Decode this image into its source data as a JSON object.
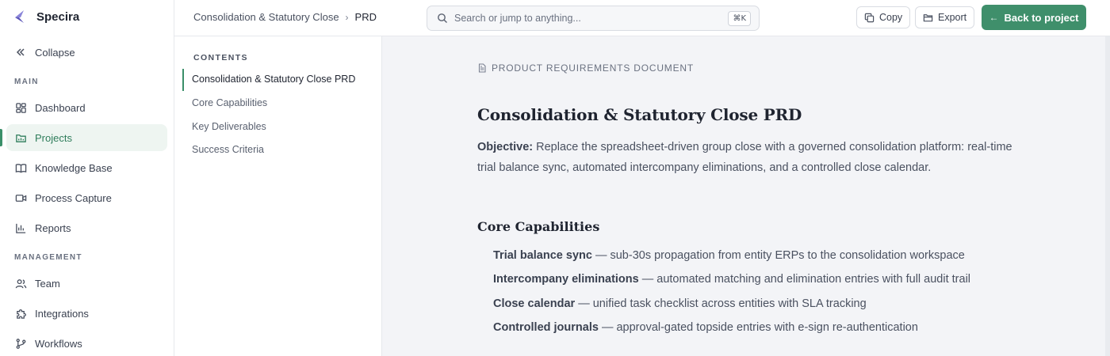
{
  "brand": {
    "name": "Specira",
    "accent": "#3f8f6b"
  },
  "sidebar": {
    "collapse_label": "Collapse",
    "sections": {
      "main": "MAIN",
      "management": "MANAGEMENT"
    },
    "items": [
      {
        "label": "Dashboard",
        "icon": "dashboard-icon"
      },
      {
        "label": "Projects",
        "icon": "folder-icon",
        "active": true
      },
      {
        "label": "Knowledge Base",
        "icon": "book-icon"
      },
      {
        "label": "Process Capture",
        "icon": "video-icon"
      },
      {
        "label": "Reports",
        "icon": "bar-chart-icon"
      },
      {
        "label": "Team",
        "icon": "users-icon"
      },
      {
        "label": "Integrations",
        "icon": "puzzle-icon"
      },
      {
        "label": "Workflows",
        "icon": "git-branch-icon"
      }
    ]
  },
  "header": {
    "breadcrumb": [
      "Consolidation & Statutory Close",
      "PRD"
    ],
    "breadcrumb_sep": "›",
    "search_placeholder": "Search or jump to anything...",
    "search_shortcut": "⌘K",
    "copy_label": "Copy",
    "export_label": "Export",
    "back_label": "Back to project"
  },
  "toc": {
    "title": "CONTENTS",
    "items": [
      "Consolidation & Statutory Close PRD",
      "Core Capabilities",
      "Key Deliverables",
      "Success Criteria"
    ]
  },
  "doc": {
    "kicker": "PRODUCT REQUIREMENTS DOCUMENT",
    "title": "Consolidation & Statutory Close PRD",
    "objective_label": "Objective:",
    "objective_text": " Replace the spreadsheet-driven group close with a governed consolidation platform: real-time trial balance sync, automated intercompany eliminations, and a controlled close calendar.",
    "section_title": "Core Capabilities",
    "capabilities": [
      {
        "name": "Trial balance sync",
        "desc": " — sub-30s propagation from entity ERPs to the consolidation workspace"
      },
      {
        "name": "Intercompany eliminations",
        "desc": " — automated matching and elimination entries with full audit trail"
      },
      {
        "name": "Close calendar",
        "desc": " — unified task checklist across entities with SLA tracking"
      },
      {
        "name": "Controlled journals",
        "desc": " — approval-gated topside entries with e-sign re-authentication"
      }
    ]
  }
}
